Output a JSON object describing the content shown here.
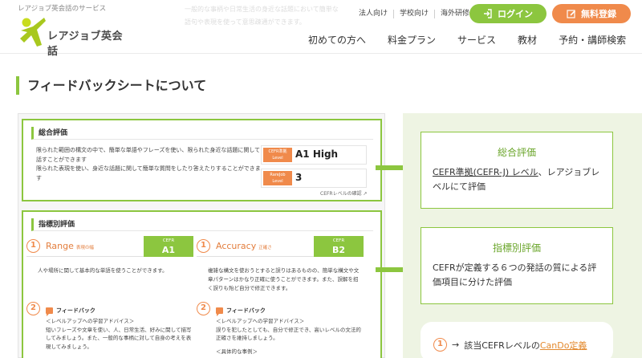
{
  "header": {
    "service_label": "レアジョブ英会話のサービス",
    "logo_text": "レアジョブ英会話",
    "faint_line_1": "一般的な事柄や日常生活の身近な話題において簡単な",
    "faint_line_2": "語句や表現を使って意思疎通ができます。",
    "top_links": [
      "法人向け",
      "学校向け",
      "海外研修"
    ],
    "login_label": "ログイン",
    "register_label": "無料登録",
    "nav": [
      "初めての方へ",
      "料金プラン",
      "サービス",
      "教材",
      "予約・講師検索"
    ],
    "colors": {
      "brand_green": "#8cc63f",
      "brand_orange": "#f08a4b"
    }
  },
  "page": {
    "title": "フィードバックシートについて"
  },
  "sheet": {
    "overall": {
      "heading": "総合評価",
      "desc_1": "限られた範囲の構文の中で、簡単な単語やフレーズを使い、限られた身近な話題に関して話すことができます",
      "desc_2": "限られた表現を使い、身近な話題に関して簡単な質問をしたり答えたりすることができます",
      "cefr_tag_1": "CEFR準拠",
      "cefr_tag_2": "Level",
      "cefr_value": "A1 High",
      "rarejob_tag_1": "RareJob",
      "rarejob_tag_2": "Level",
      "rarejob_value": "3",
      "cefr_link": "CEFRレベルの確認"
    },
    "indicator": {
      "heading": "指標別評価",
      "left": {
        "num": "1",
        "title": "Range",
        "subtitle": "表現の幅",
        "cefr_label": "CEFR",
        "cefr_value": "A1",
        "desc": "人や場所に関して基本的な単語を使うことができます。",
        "fb_num": "2",
        "fb_label": "フィードバック",
        "fb_1": "＜レベルアップへの学習アドバイス＞",
        "fb_2": "短いフレーズや文章を使い、人、日常生活、好みに関して描写してみましょう。また、一般的な事柄に対して自身の考えを表現してみましょう。"
      },
      "right": {
        "num": "1",
        "title": "Accuracy",
        "subtitle": "正確さ",
        "cefr_label": "CEFR",
        "cefr_value": "B2",
        "desc": "複雑な構文を使おうとすると誤りはあるものの、簡単な構文や文章パターンはかなり正確に使うことができます。また、誤解を招く誤りも殆ど自分で修正できます。",
        "fb_num": "2",
        "fb_label": "フィードバック",
        "fb_1": "＜レベルアップへの学習アドバイス＞",
        "fb_2": "誤りを犯したとしても、自分で修正でき、高いレベルの文法的正確さを維持しましょう。",
        "fb_3": "＜具体的な事例＞"
      }
    }
  },
  "right_panel": {
    "card_1": {
      "title": "総合評価",
      "link_text": "CEFR準拠(CEFR-J) レベル",
      "body_rest": "、レアジョブレベルにて評価"
    },
    "card_2": {
      "title": "指標別評価",
      "body": "CEFRが定義する６つの発話の質による評価項目に分けた評価"
    },
    "card_3": {
      "num": "1",
      "arrow": "→",
      "text": "該当CEFRレベルの",
      "link_text": "CanDo定義"
    }
  }
}
